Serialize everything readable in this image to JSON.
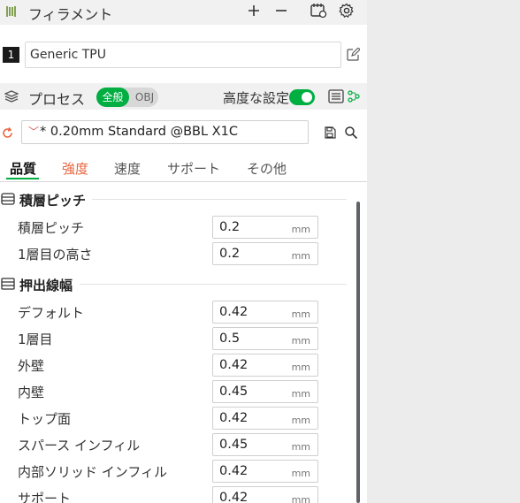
{
  "filament": {
    "title": "フィラメント",
    "icons": [
      "filament-icon",
      "plus-icon",
      "minus-icon",
      "filament-settings-icon",
      "gear-icon"
    ],
    "item": {
      "index": "1",
      "name": "Generic TPU",
      "edit_icon": "edit-icon"
    }
  },
  "process": {
    "title": "プロセス",
    "mode": {
      "global_label": "全般",
      "object_label": "OBJ",
      "selected": "全般"
    },
    "advanced": {
      "label": "高度な設定",
      "enabled": true
    },
    "preset": {
      "name": "* 0.20mm Standard @BBL X1C",
      "modified": true
    }
  },
  "tabs": [
    {
      "label": "品質",
      "active": true
    },
    {
      "label": "強度",
      "warning": true
    },
    {
      "label": "速度"
    },
    {
      "label": "サポート"
    },
    {
      "label": "その他"
    }
  ],
  "sections": [
    {
      "title": "積層ピッチ",
      "rows": [
        {
          "label": "積層ピッチ",
          "value": "0.2",
          "unit": "mm"
        },
        {
          "label": "1層目の高さ",
          "value": "0.2",
          "unit": "mm"
        }
      ]
    },
    {
      "title": "押出線幅",
      "rows": [
        {
          "label": "デフォルト",
          "value": "0.42",
          "unit": "mm"
        },
        {
          "label": "1層目",
          "value": "0.5",
          "unit": "mm"
        },
        {
          "label": "外壁",
          "value": "0.42",
          "unit": "mm"
        },
        {
          "label": "内壁",
          "value": "0.45",
          "unit": "mm"
        },
        {
          "label": "トップ面",
          "value": "0.42",
          "unit": "mm"
        },
        {
          "label": "スパース インフィル",
          "value": "0.45",
          "unit": "mm"
        },
        {
          "label": "内部ソリッド インフィル",
          "value": "0.42",
          "unit": "mm"
        },
        {
          "label": "サポート",
          "value": "0.42",
          "unit": "mm"
        }
      ]
    }
  ],
  "colors": {
    "accent": "#00ae42",
    "warning": "#e8643c",
    "header_bg": "#f1f1f1",
    "panel_bg": "#ffffff",
    "outside_bg": "#ececec"
  }
}
